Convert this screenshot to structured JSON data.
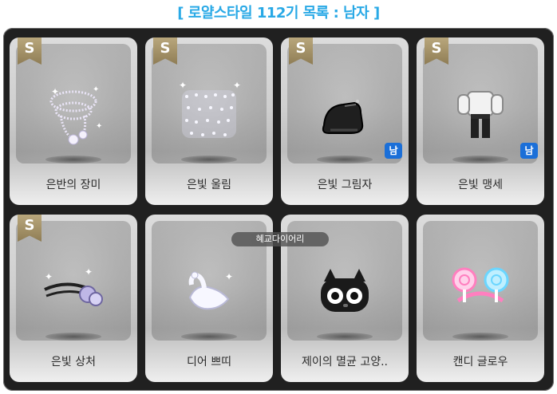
{
  "header": {
    "title": "[ 로얄스타일 112기 목록 : 남자 ]"
  },
  "watermark": "혜교다이어리",
  "grade_badge": "S",
  "gender_badge": "남",
  "items": [
    {
      "name": "은반의 장미",
      "icon": "silver-rose-necklace-icon",
      "grade": true,
      "gender": false
    },
    {
      "name": "은빛 울림",
      "icon": "silver-sparkle-curtain-icon",
      "grade": true,
      "gender": false
    },
    {
      "name": "은빛 그림자",
      "icon": "black-shoes-icon",
      "grade": true,
      "gender": true
    },
    {
      "name": "은빛 맹세",
      "icon": "white-shirt-black-pants-icon",
      "grade": true,
      "gender": true
    },
    {
      "name": "은빛 상처",
      "icon": "thorn-rose-crown-icon",
      "grade": true,
      "gender": false
    },
    {
      "name": "디어 쁘띠",
      "icon": "white-swan-icon",
      "grade": false,
      "gender": false
    },
    {
      "name": "제이의 멸균 고양..",
      "icon": "black-cat-mask-icon",
      "grade": false,
      "gender": false
    },
    {
      "name": "캔디 글로우",
      "icon": "candy-headband-icon",
      "grade": false,
      "gender": false
    }
  ]
}
